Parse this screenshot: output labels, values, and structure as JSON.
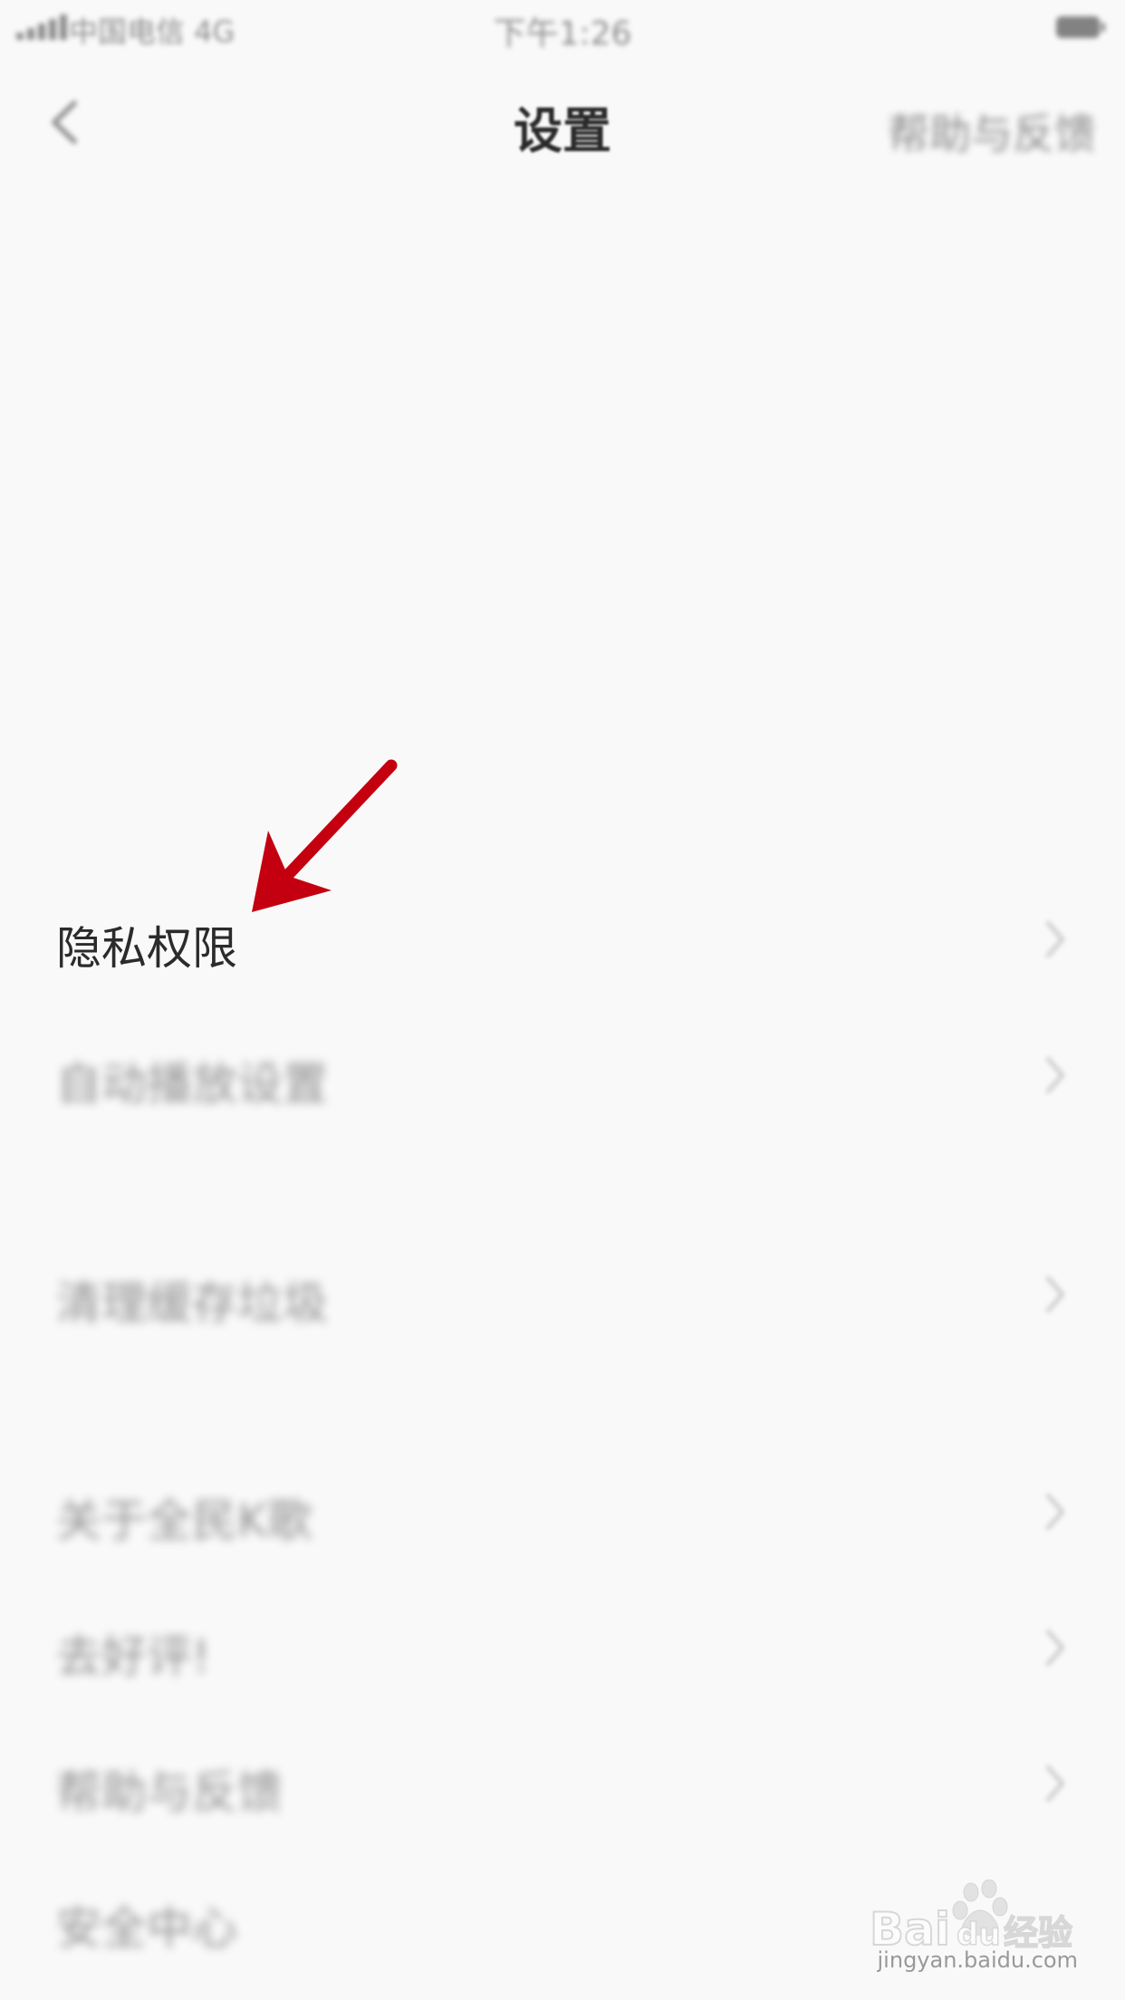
{
  "status_bar": {
    "carrier": "中国电信 4G",
    "time": "下午1:26"
  },
  "nav": {
    "title": "设置",
    "help_link": "帮助与反馈"
  },
  "rows": [
    {
      "label": "隐私权限",
      "highlighted": true
    },
    {
      "label": "自动播放设置",
      "highlighted": false
    },
    {
      "label": "清理缓存垃圾",
      "highlighted": false
    },
    {
      "label": "关于全民K歌",
      "highlighted": false
    },
    {
      "label": "去好评!",
      "highlighted": false
    },
    {
      "label": "帮助与反馈",
      "highlighted": false
    },
    {
      "label": "安全中心",
      "highlighted": false
    }
  ],
  "watermark": {
    "brand": "Baidu经验",
    "url": "jingyan.baidu.com"
  },
  "colors": {
    "annotation_arrow": "#c40010",
    "background": "#f9f9f9"
  }
}
